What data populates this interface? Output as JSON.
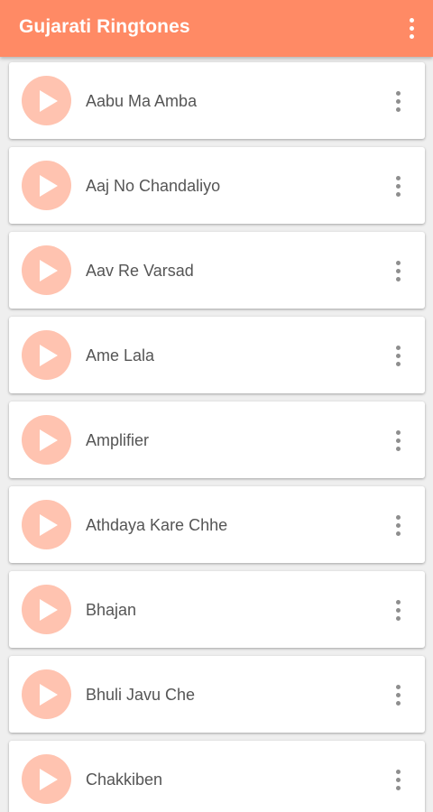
{
  "app_bar": {
    "title": "Gujarati Ringtones",
    "background_color": "#ff8a65",
    "menu_icon": "more-vert-icon"
  },
  "ringtones": [
    {
      "title": "Aabu Ma Amba"
    },
    {
      "title": "Aaj No Chandaliyo"
    },
    {
      "title": "Aav Re Varsad"
    },
    {
      "title": "Ame Lala"
    },
    {
      "title": "Amplifier"
    },
    {
      "title": "Athdaya Kare Chhe"
    },
    {
      "title": "Bhajan"
    },
    {
      "title": "Bhuli Javu Che"
    },
    {
      "title": "Chakkiben"
    }
  ],
  "item_icons": {
    "play": "play-icon",
    "menu": "more-vert-icon"
  },
  "colors": {
    "play_button_bg": "#ffc3b0",
    "title_text": "#555555",
    "list_background": "#efefef"
  }
}
